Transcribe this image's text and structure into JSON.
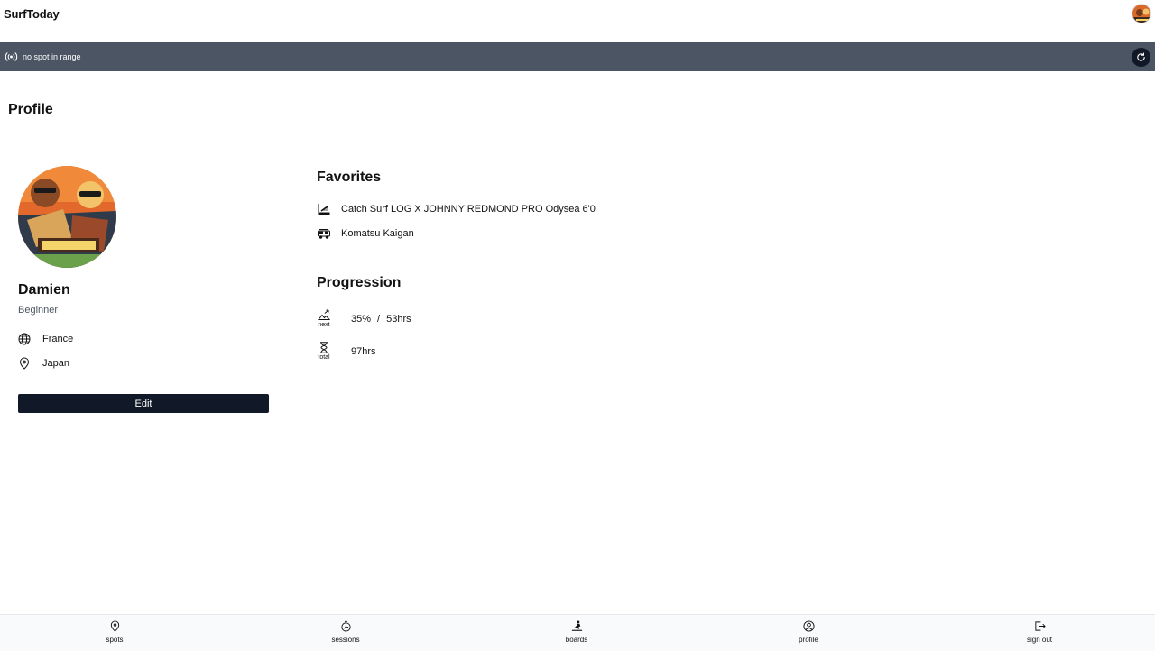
{
  "app": {
    "brand": "SurfToday"
  },
  "status": {
    "text": "no spot in range"
  },
  "page": {
    "title": "Profile"
  },
  "user": {
    "name": "Damien",
    "level": "Beginner",
    "country": "France",
    "location": "Japan",
    "edit_label": "Edit"
  },
  "favorites": {
    "title": "Favorites",
    "board": "Catch Surf LOG X JOHNNY REDMOND PRO Odysea 6'0",
    "spot": "Komatsu Kaigan"
  },
  "progression": {
    "title": "Progression",
    "next_caption": "next",
    "next_percent": "35%",
    "separator": "/",
    "next_hours": "53hrs",
    "total_caption": "total",
    "total_hours": "97hrs"
  },
  "nav": {
    "spots": "spots",
    "sessions": "sessions",
    "boards": "boards",
    "profile": "profile",
    "signout": "sign out"
  },
  "colors": {
    "status_bar": "#4b5563",
    "primary_dark": "#111827",
    "muted_text": "#4b5563"
  }
}
